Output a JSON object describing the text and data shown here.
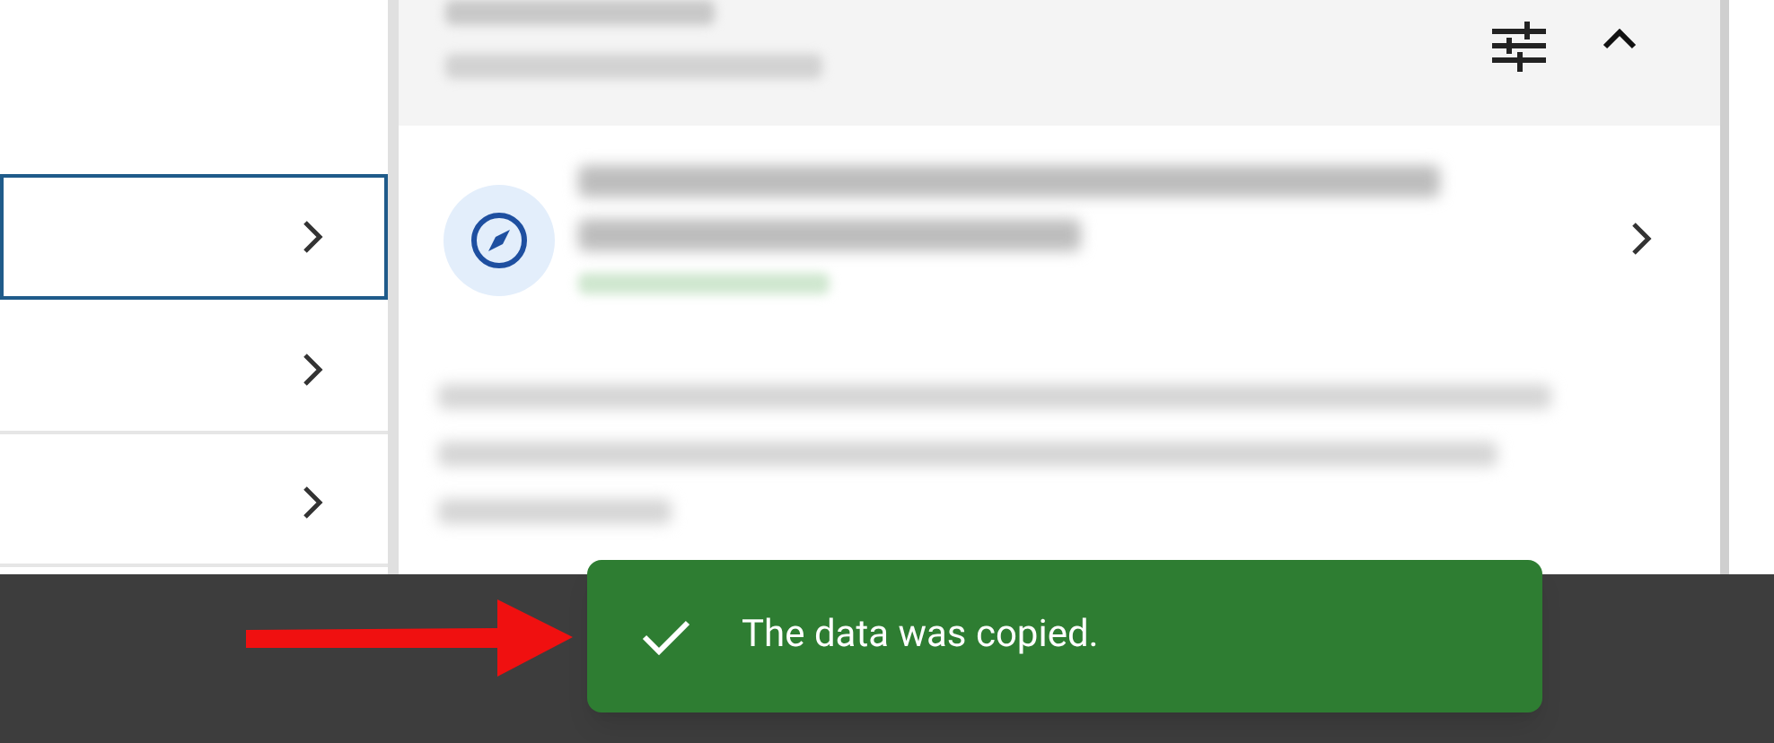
{
  "left_list": {
    "items": [
      {
        "selected": true
      },
      {
        "selected": false
      },
      {
        "selected": false
      }
    ]
  },
  "toast": {
    "message": "The data was copied."
  }
}
